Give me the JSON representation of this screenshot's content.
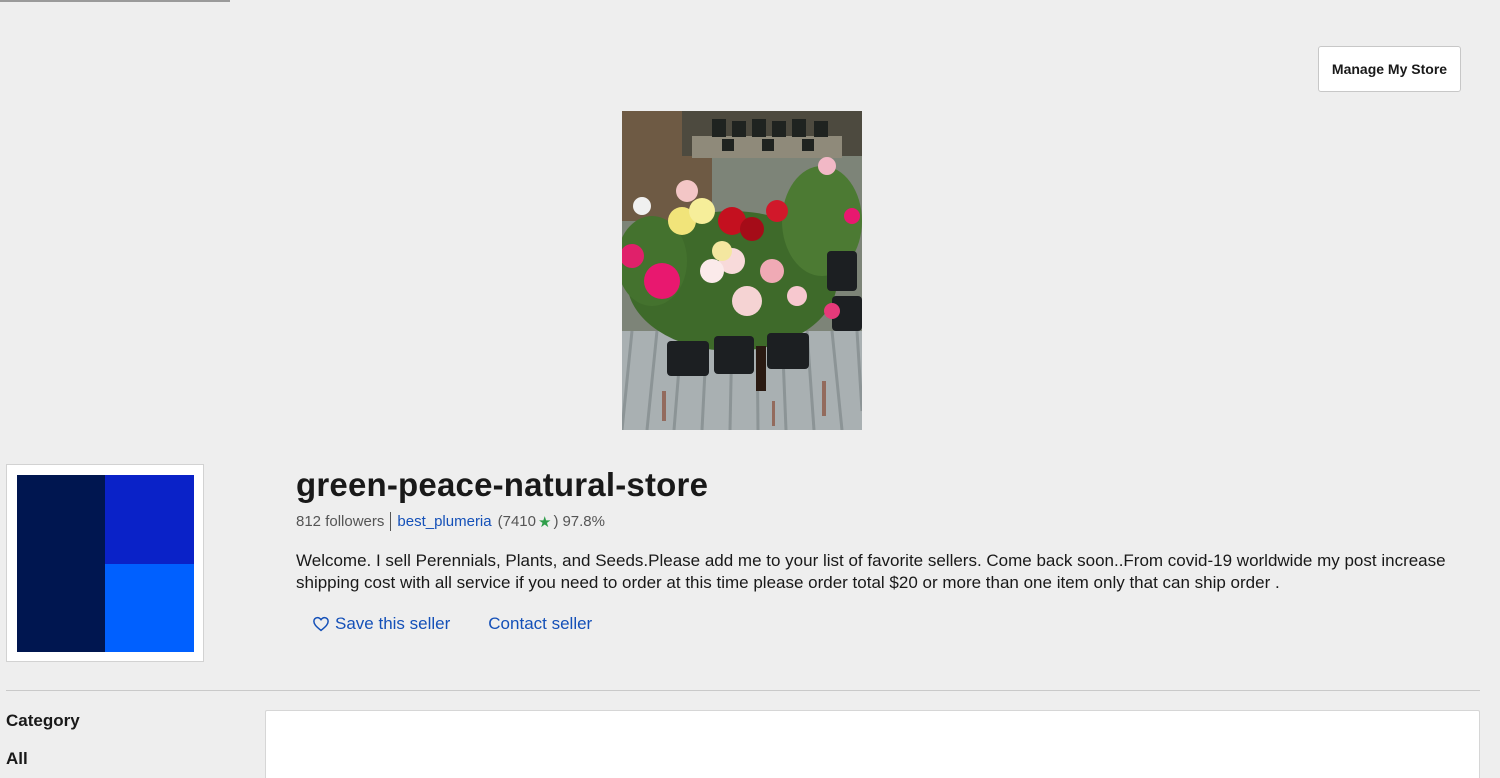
{
  "header": {
    "manage_store_label": "Manage My Store"
  },
  "store": {
    "name": "green-peace-natural-store",
    "followers": "812 followers",
    "seller_username": "best_plumeria",
    "feedback_open": "(7410",
    "feedback_close": ")",
    "positive_feedback": "97.8%",
    "description": "Welcome. I sell Perennials, Plants, and Seeds.Please add me to your list of favorite sellers. Come back soon..From covid-19 worldwide my post increase shipping cost with all service if you need to order at this time please order total $20 or more than one item only that can ship order ."
  },
  "actions": {
    "save_seller_label": "Save this seller",
    "contact_seller_label": "Contact seller"
  },
  "sidebar": {
    "category_heading": "Category",
    "items": [
      {
        "label": "All"
      }
    ]
  },
  "icons": {
    "star": "★",
    "heart": "heart-outline-icon"
  },
  "colors": {
    "link": "#1450b8",
    "star": "#2e9e4a",
    "logo_dark": "#001650",
    "logo_mid": "#0a22c8",
    "logo_bright": "#0060ff"
  }
}
